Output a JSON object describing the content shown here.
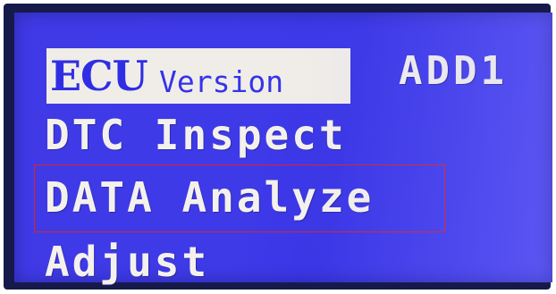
{
  "menu": {
    "row1": {
      "ecu": "ECU",
      "version": "Version",
      "add": "ADD1"
    },
    "items": [
      {
        "label": "DTC Inspect"
      },
      {
        "label": "DATA Analyze"
      },
      {
        "label": "Adjust"
      }
    ],
    "selected_index": 1
  },
  "colors": {
    "screen_background": "#3f3ae6",
    "text": "#f4f1ec",
    "highlight_bar": "#f0ede8",
    "highlight_text": "#2f2ee4",
    "selection_outline": "#e0241e",
    "bezel": "#161a4a"
  }
}
